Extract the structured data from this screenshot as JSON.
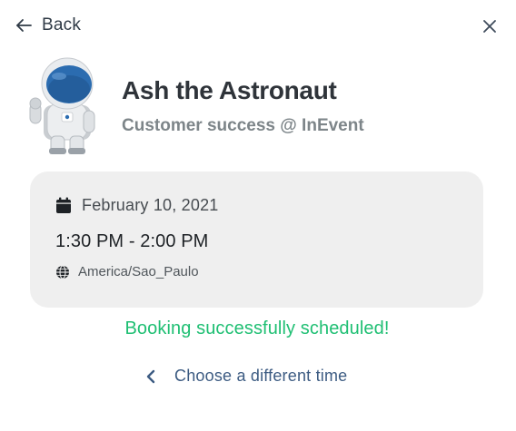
{
  "header": {
    "back_label": "Back",
    "back_icon": "arrow-left-icon",
    "close_icon": "close-icon"
  },
  "host": {
    "name": "Ash the Astronaut",
    "role": "Customer success @ InEvent",
    "avatar_icon": "astronaut-avatar"
  },
  "booking": {
    "date": "February 10, 2021",
    "date_icon": "calendar-icon",
    "time_range": "1:30 PM - 2:00 PM",
    "timezone": "America/Sao_Paulo",
    "timezone_icon": "globe-icon",
    "status": "Booking successfully scheduled!",
    "change_time_label": "Choose a different time",
    "change_time_icon": "chevron-left-icon"
  },
  "colors": {
    "success": "#1fbf73",
    "link": "#3c5b82",
    "card_background": "#efefef",
    "helmet_blue": "#2b6cb0"
  }
}
